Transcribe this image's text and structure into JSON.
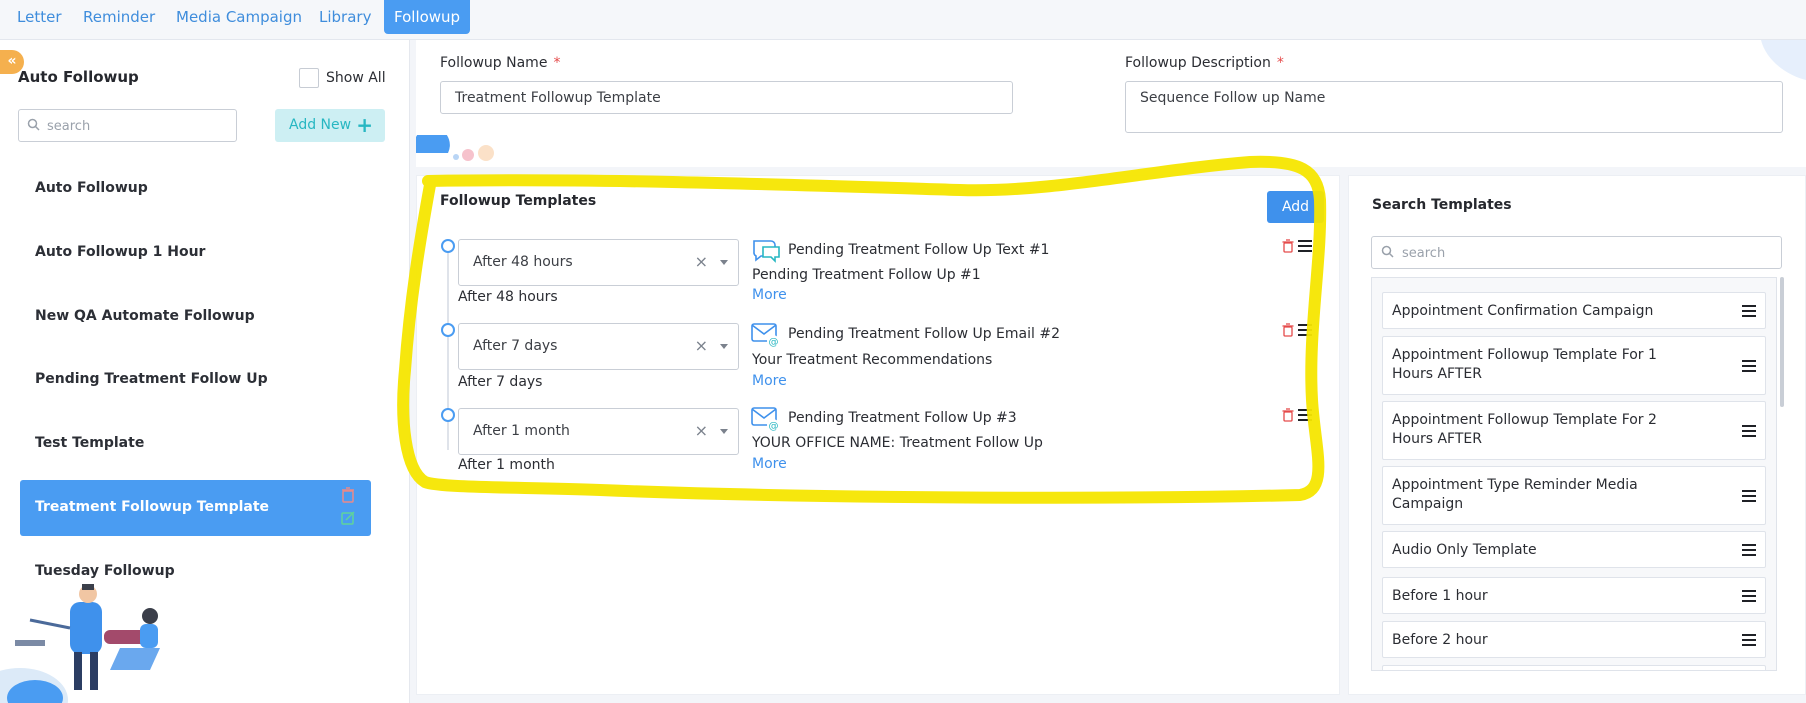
{
  "tabs": [
    "Letter",
    "Reminder",
    "Media Campaign",
    "Library",
    "Followup"
  ],
  "sidebar": {
    "collapse_icon": "«",
    "title": "Auto Followup",
    "show_all_label": "Show All",
    "search_placeholder": "search",
    "add_new_label": "Add New",
    "add_new_icon": "+",
    "items": [
      "Auto Followup",
      "Auto Followup 1 Hour",
      "New QA Automate Followup",
      "Pending Treatment Follow Up",
      "Test Template",
      "Treatment Followup Template",
      "Tuesday Followup"
    ]
  },
  "form": {
    "name_label": "Followup Name",
    "name_value": "Treatment Followup Template",
    "desc_label": "Followup Description",
    "desc_value": "Sequence Follow up Name",
    "required_mark": "*"
  },
  "followup_templates": {
    "title": "Followup Templates",
    "add_label": "Add",
    "items": [
      {
        "delay": "After 48 hours",
        "delay_sub": "After 48 hours",
        "type": "text",
        "name": "Pending Treatment Follow Up Text #1",
        "subject": "Pending Treatment Follow Up #1",
        "more": "More"
      },
      {
        "delay": "After 7 days",
        "delay_sub": "After 7 days",
        "type": "email",
        "name": "Pending Treatment Follow Up Email #2",
        "subject": "Your Treatment Recommendations",
        "more": "More"
      },
      {
        "delay": "After 1 month",
        "delay_sub": "After 1 month",
        "type": "email",
        "name": "Pending Treatment Follow Up #3",
        "subject": "YOUR OFFICE NAME: Treatment Follow Up",
        "more": "More"
      }
    ]
  },
  "search_templates": {
    "title": "Search Templates",
    "search_placeholder": "search",
    "items": [
      "Appointment Confirmation Campaign",
      "Appointment Followup Template For 1 Hours AFTER",
      "Appointment Followup Template For 2 Hours AFTER",
      "Appointment Type Reminder Media Campaign",
      "Audio Only Template",
      "Before 1 hour",
      "Before 2 hour"
    ]
  },
  "colors": {
    "primary": "#4a9cf2",
    "annotation": "#f5e600",
    "danger": "#e54b4b",
    "accent": "#27b7c2"
  }
}
